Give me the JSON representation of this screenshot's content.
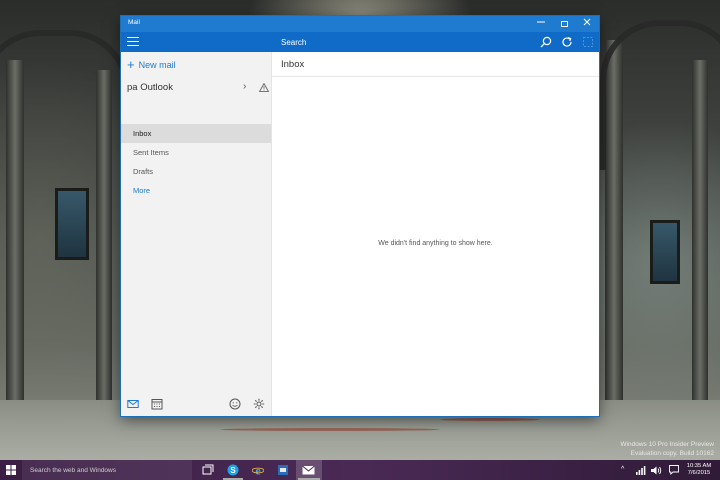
{
  "window": {
    "title": "Mail"
  },
  "header": {
    "search_placeholder": "Search"
  },
  "sidebar": {
    "new_mail_label": "New mail",
    "account_name": "pa Outlook",
    "folders": [
      "Inbox",
      "Sent Items",
      "Drafts"
    ],
    "more_label": "More"
  },
  "main": {
    "folder_title": "Inbox",
    "empty_message": "We didn't find anything to show here."
  },
  "taskbar": {
    "search_placeholder": "Search the web and Windows",
    "time": "10:35 AM",
    "date": "7/6/2015"
  },
  "watermark": {
    "line1": "Windows 10 Pro Insider Preview",
    "line2": "Evaluation copy. Build 10162"
  },
  "colors": {
    "accent": "#0f6bc7",
    "titlebar": "#1f7bd0",
    "taskbar": "#3b1e44"
  },
  "icons": [
    "hamburger-icon",
    "search-icon",
    "sync-icon",
    "select-icon",
    "plus-icon",
    "chevron-right-icon",
    "warning-icon",
    "mail-icon",
    "calendar-icon",
    "feedback-icon",
    "settings-icon",
    "windows-logo-icon",
    "task-view-icon",
    "skype-icon",
    "ie-icon",
    "explorer-icon",
    "mail-app-icon"
  ]
}
